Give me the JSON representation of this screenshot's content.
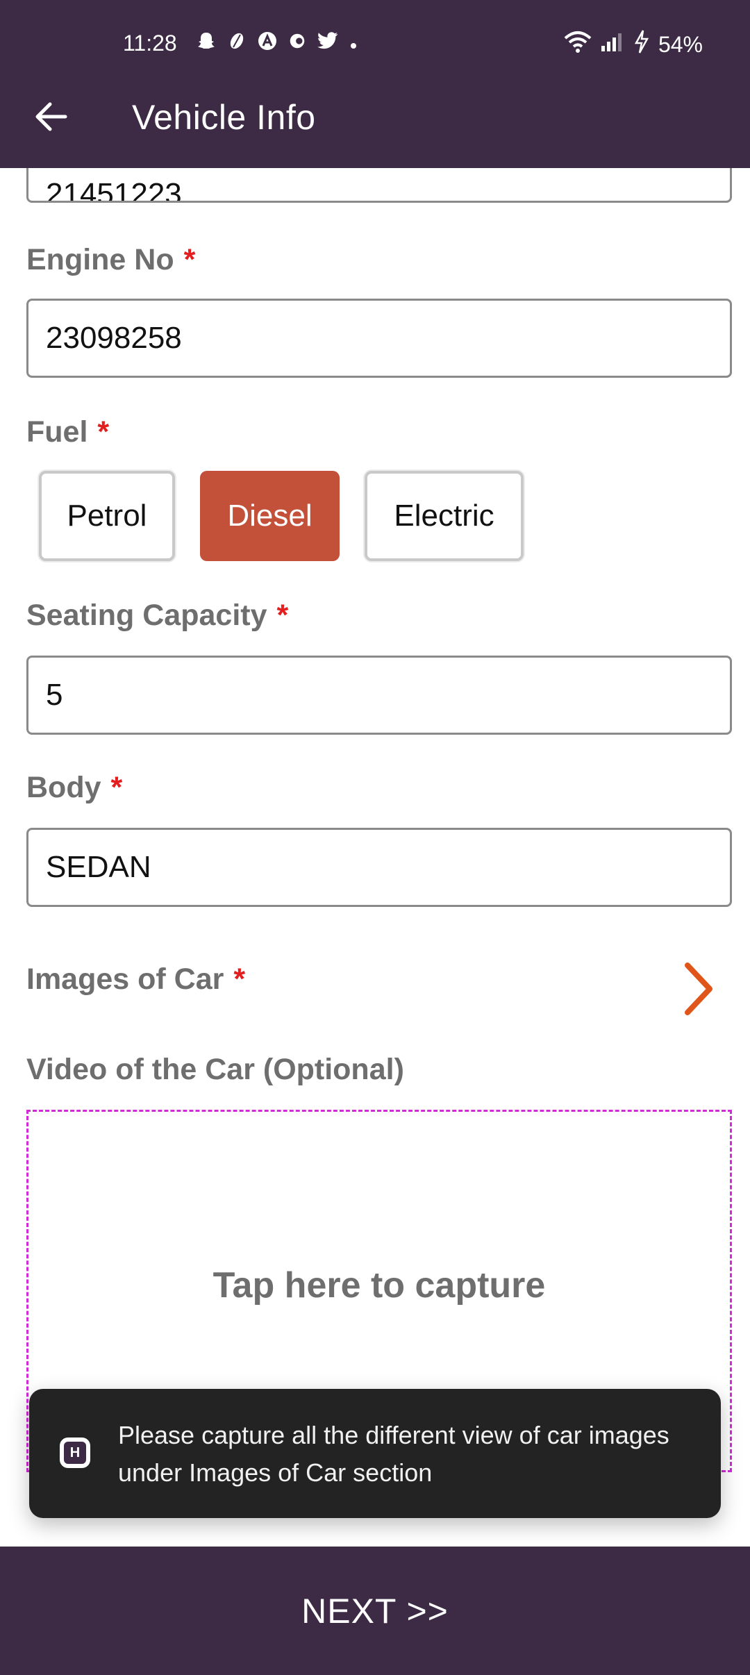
{
  "status_bar": {
    "time": "11:28",
    "battery": "54%",
    "notification_icons": [
      "snapchat-icon",
      "leaf-icon",
      "app-a-icon",
      "app-c-icon",
      "twitter-icon",
      "dot-icon"
    ]
  },
  "header": {
    "title": "Vehicle Info",
    "back_icon": "arrow-left-icon"
  },
  "form": {
    "partial_previous_value": "21451223",
    "engine_no": {
      "label": "Engine No",
      "required": "*",
      "value": "23098258"
    },
    "fuel": {
      "label": "Fuel",
      "required": "*",
      "options": [
        "Petrol",
        "Diesel",
        "Electric"
      ],
      "selected": "Diesel"
    },
    "seating_capacity": {
      "label": "Seating Capacity",
      "required": "*",
      "value": "5"
    },
    "body": {
      "label": "Body",
      "required": "*",
      "value": "SEDAN"
    },
    "images_of_car": {
      "label": "Images of Car",
      "required": "*"
    },
    "video": {
      "label": "Video of the Car (Optional)",
      "capture_text": "Tap here to capture"
    }
  },
  "toast": {
    "message": "Please capture all the different view of car images under Images of Car section",
    "icon": "app-logo-icon"
  },
  "footer": {
    "next_label": "NEXT >>"
  },
  "colors": {
    "primary": "#3d2b45",
    "selected_chip": "#c3513a",
    "required_star": "#e41e1e",
    "chevron": "#e0551a",
    "dashed_border": "#d12ad6"
  }
}
